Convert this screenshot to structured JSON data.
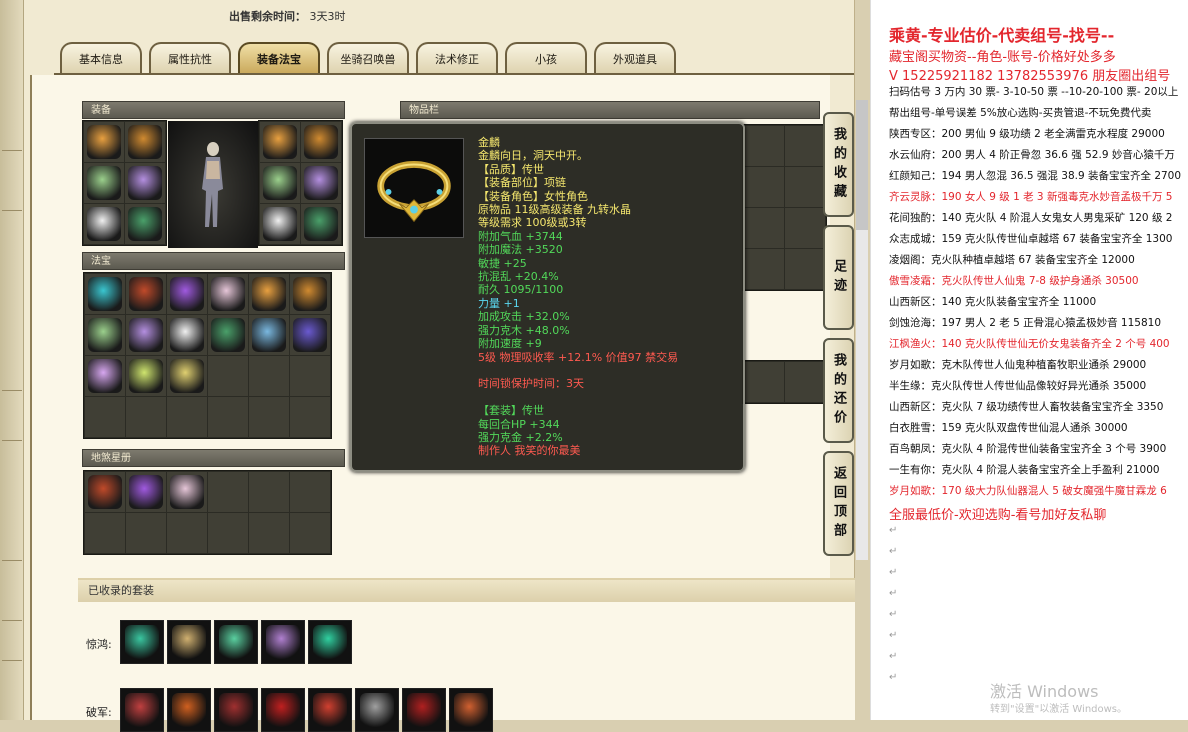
{
  "header": {
    "timer_label": "出售剩余时间：",
    "timer_value": "3天3时"
  },
  "tabs": [
    "基本信息",
    "属性抗性",
    "装备法宝",
    "坐骑召唤兽",
    "法术修正",
    "小孩",
    "外观道具"
  ],
  "active_tab": "装备法宝",
  "panels": {
    "equipment": "装备",
    "fabao": "法宝",
    "earth_star": "地煞星册",
    "inventory": "物品栏",
    "suits": "已收录的套装"
  },
  "suit_rows": [
    "惊鸿:",
    "破军:"
  ],
  "sidebar": [
    "我的收藏",
    "足迹",
    "我的还价",
    "返回顶部"
  ],
  "tooltip": {
    "lines": [
      {
        "text": "金麟",
        "color": "yellow"
      },
      {
        "text": "金麟向日，洞天中开。",
        "color": "yellow"
      },
      {
        "text": "【品质】传世",
        "color": "yellow"
      },
      {
        "text": "【装备部位】项链",
        "color": "yellow"
      },
      {
        "text": "【装备角色】女性角色",
        "color": "yellow"
      },
      {
        "text": "原物品 11级高级装备 九转水晶",
        "color": "yellow"
      },
      {
        "text": "等级需求 100级或3转",
        "color": "yellow"
      },
      {
        "text": "附加气血 +3744",
        "color": "green"
      },
      {
        "text": "附加魔法 +3520",
        "color": "green"
      },
      {
        "text": "敏捷 +25",
        "color": "green"
      },
      {
        "text": "抗混乱 +20.4%",
        "color": "green"
      },
      {
        "text": "耐久 1095/1100",
        "color": "green"
      },
      {
        "text": "力量 +1",
        "color": "cyan"
      },
      {
        "text": "加成攻击 +32.0%",
        "color": "green"
      },
      {
        "text": "强力克木 +48.0%",
        "color": "green"
      },
      {
        "text": "附加速度 +9",
        "color": "green"
      },
      {
        "text": "5级 物理吸收率 +12.1% 价值97 禁交易",
        "color": "red"
      },
      {
        "text": "",
        "color": "yellow"
      },
      {
        "text": "时间锁保护时间：3天",
        "color": "red"
      },
      {
        "text": "",
        "color": "yellow"
      },
      {
        "text": "【套装】传世",
        "color": "green"
      },
      {
        "text": "每回合HP +344",
        "color": "green"
      },
      {
        "text": "强力克金 +2.2%",
        "color": "green"
      },
      {
        "text": "制作人 我笑的你最美",
        "color": "red"
      }
    ]
  },
  "right_panel": {
    "lines": [
      {
        "text": "乘黄-专业估价-代卖组号-找号--",
        "style": "title"
      },
      {
        "text": "藏宝阁买物资--角色-账号-价格好处多多",
        "style": "big"
      },
      {
        "text": "V 15225921182   13782553976 朋友圈出组号",
        "style": "big"
      },
      {
        "text": "扫码估号 3 万内 30 票- 3-10-50 票 --10-20-100 票- 20以上",
        "style": "normal"
      },
      {
        "text": "帮出组号-单号误差 5%放心选购-买贵管退-不玩免费代卖",
        "style": "normal"
      },
      {
        "text": "陕西专区：200 男仙 9 级功绩 2 老全满雷克水程度 29000",
        "style": "normal"
      },
      {
        "text": "水云仙府：200 男人 4 阶正骨忽 36.6 强 52.9 妙音心猿千万",
        "style": "normal"
      },
      {
        "text": "红颜知己：194 男人忽混 36.5 强混 38.9 装备宝宝齐全 2700",
        "style": "normal"
      },
      {
        "text": "齐云灵脉：190 女人 9 级 1 老 3 新强毒克水妙音孟极千万 5",
        "style": "red"
      },
      {
        "text": "花间独酌：140 克火队 4 阶混人女鬼女人男鬼采矿 120 级 2",
        "style": "normal"
      },
      {
        "text": "众志成城：159 克火队传世仙卓越塔 67 装备宝宝齐全 1300",
        "style": "normal"
      },
      {
        "text": "凌烟阁：克火队种植卓越塔 67 装备宝宝齐全 12000",
        "style": "normal"
      },
      {
        "text": "傲雪凌霜：克火队传世人仙鬼 7-8 级护身通杀 30500",
        "style": "red"
      },
      {
        "text": "山西新区：140 克火队装备宝宝齐全 11000",
        "style": "normal"
      },
      {
        "text": "剑蚀沧海：197 男人 2 老 5 正骨混心猿孟极妙音 115810",
        "style": "normal"
      },
      {
        "text": "江枫渔火：140 克火队传世仙无价女鬼装备齐全 2 个号 400",
        "style": "red"
      },
      {
        "text": "岁月如歌：克木队传世人仙鬼种植畜牧职业通杀 29000",
        "style": "normal"
      },
      {
        "text": "半生缘：克火队传世人传世仙品像较好异光通杀 35000",
        "style": "normal"
      },
      {
        "text": "山西新区：克火队 7 级功绩传世人畜牧装备宝宝齐全 3350",
        "style": "normal"
      },
      {
        "text": "白衣胜雪：159 克火队双盘传世仙混人通杀 30000",
        "style": "normal"
      },
      {
        "text": "百鸟朝凤：克火队 4 阶混传世仙装备宝宝齐全 3 个号 3900",
        "style": "normal"
      },
      {
        "text": "一生有你：克火队 4 阶混人装备宝宝齐全上手盈利 21000",
        "style": "normal"
      },
      {
        "text": "岁月如歌：170 级大力队仙器混人 5 破女魔强牛魔甘霖龙 6",
        "style": "red"
      },
      {
        "text": "全服最低价-欢迎选购-看号加好友私聊",
        "style": "big"
      }
    ],
    "empty_paragraphs": 8
  },
  "watermark": {
    "line1": "激活 Windows",
    "line2": "转到\"设置\"以激活 Windows。"
  },
  "colors": {
    "panel_bg": "#fbf7e8",
    "tooltip_bg": "#24241e",
    "accent_red": "#e3262d"
  }
}
